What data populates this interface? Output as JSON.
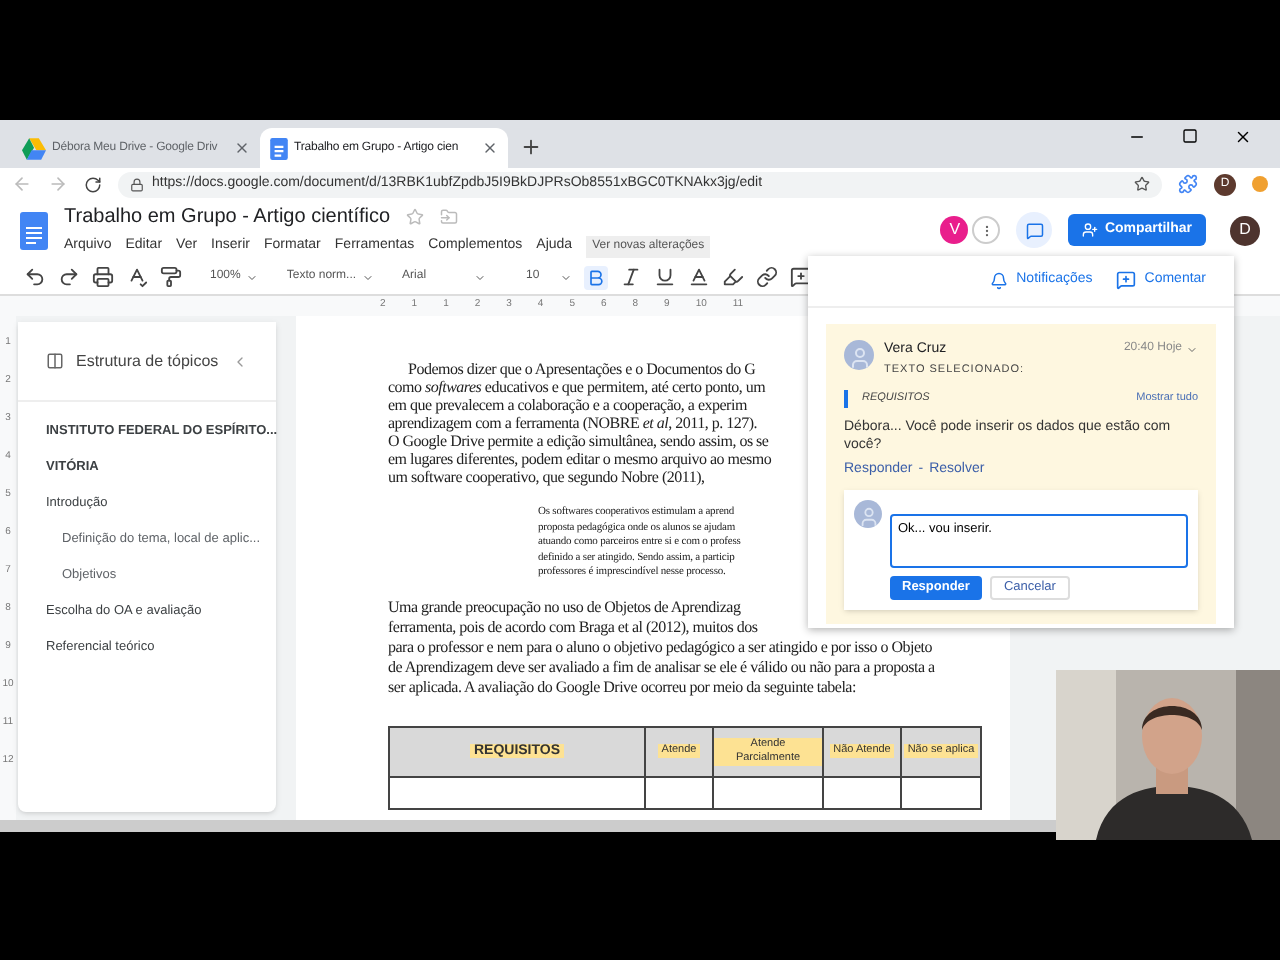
{
  "browser": {
    "tabs": [
      {
        "title": "Débora Meu Drive - Google Driv",
        "kind": "drive",
        "selected": false
      },
      {
        "title": "Trabalho em Grupo - Artigo cien",
        "kind": "docs",
        "selected": true
      }
    ],
    "url": "https://docs.google.com/document/d/13RBK1ubfZpdbJ5I9BkDJPRsOb8551xBGC0TKNAkx3jg/edit",
    "profile_initial": "D"
  },
  "docs": {
    "title": "Trabalho em Grupo - Artigo científico",
    "menu": [
      "Arquivo",
      "Editar",
      "Ver",
      "Inserir",
      "Formatar",
      "Ferramentas",
      "Complementos",
      "Ajuda"
    ],
    "changes_link": "Ver novas alterações",
    "collaborator_initial": "V",
    "share_button": "Compartilhar",
    "account_initial": "D"
  },
  "toolbar": {
    "zoom": "100%",
    "style": "Texto norm...",
    "font": "Arial",
    "size": "10",
    "bold_active": true
  },
  "ruler": {
    "horizontal": [
      "2",
      "1",
      "1",
      "2",
      "3",
      "4",
      "5",
      "6",
      "8",
      "9",
      "10",
      "11"
    ],
    "vertical": [
      "1",
      "2",
      "3",
      "4",
      "5",
      "6",
      "7",
      "8",
      "9",
      "10",
      "11",
      "12"
    ]
  },
  "outline": {
    "title": "Estrutura de tópicos",
    "items": [
      {
        "text": "INSTITUTO FEDERAL DO ESPÍRITO...",
        "kind": "title"
      },
      {
        "text": "VITÓRIA",
        "kind": "title"
      },
      {
        "text": "Introdução",
        "kind": "heading",
        "children": [
          {
            "text": "Definição do tema, local de aplic..."
          },
          {
            "text": "Objetivos"
          }
        ]
      },
      {
        "text": "Escolha do OA e avaliação",
        "kind": "heading"
      },
      {
        "text": "Referencial teórico",
        "kind": "heading"
      }
    ]
  },
  "document": {
    "paragraph_1": [
      "Podemos dizer que o Apresentações e o Documentos do G",
      "como *softwares* educativos e que permitem, até certo ponto, um",
      "em que prevalecem a colaboração e a cooperação, a experim",
      "aprendizagem com a ferramenta (NOBRE *et al*, 2011, p. 127).",
      "O Google Drive permite a edição simultânea, sendo assim, os se",
      "em lugares diferentes, podem editar o mesmo arquivo ao mesmo",
      "um software cooperativo, que segundo Nobre (2011),"
    ],
    "quote": [
      "Os softwares cooperativos estimulam a aprend",
      "proposta pedagógica onde os alunos se ajudam",
      "atuando como parceiros entre si e com o profess",
      "definido a ser atingido. Sendo assim, a particip",
      "professores é imprescindível nesse processo."
    ],
    "paragraph_2": [
      "Uma grande preocupação no uso de Objetos de Aprendizag",
      "ferramenta, pois de acordo com Braga et al (2012), muitos dos",
      "para o professor e nem para o aluno o objetivo pedagógico a ser atingido e por isso o Objeto",
      "de Aprendizagem deve ser avaliado a fim de analisar se ele é válido ou não para a proposta a",
      "ser aplicada. A avaliação do Google Drive ocorreu por meio da seguinte tabela:"
    ],
    "table": {
      "columns": [
        "REQUISITOS",
        "Atende",
        "Atende Parcialmente",
        "Não Atende",
        "Não se aplica"
      ]
    }
  },
  "comments": {
    "notifications": "Notificações",
    "comment_button": "Comentar",
    "comment": {
      "author": "Vera Cruz",
      "time": "20:40 Hoje",
      "selected_label": "TEXTO SELECIONADO:",
      "quote": "REQUISITOS",
      "show_all": "Mostrar tudo",
      "body": "Débora... Você pode inserir os dados que estão com você?",
      "reply_link": "Responder",
      "separator": "-",
      "resolve_link": "Resolver"
    },
    "reply": {
      "value": "Ok... vou inserir.",
      "submit": "Responder",
      "cancel": "Cancelar"
    }
  }
}
